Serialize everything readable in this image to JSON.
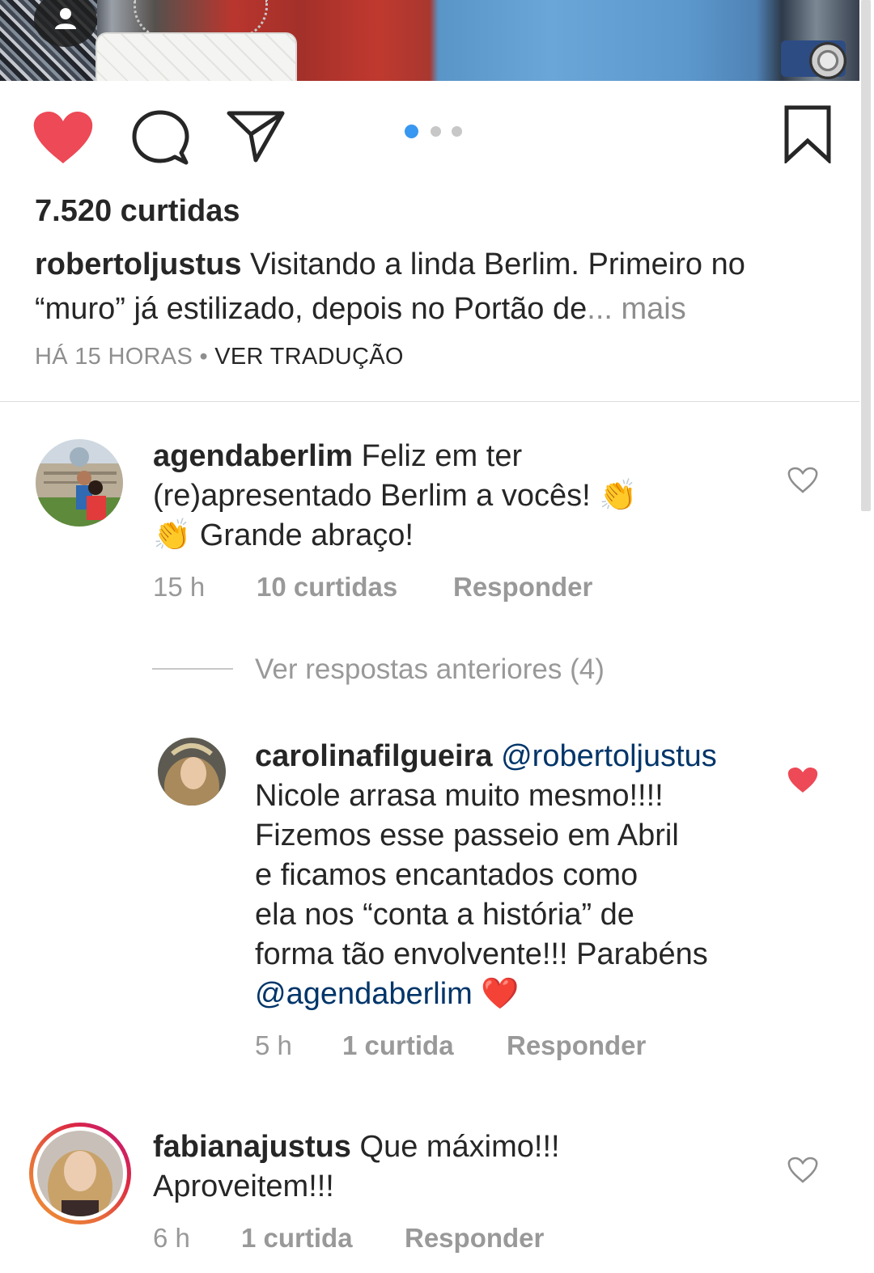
{
  "post": {
    "likes_text": "7.520 curtidas",
    "caption_user": "robertoljustus",
    "caption_text": " Visitando a linda Berlim. Primeiro no “muro” já estilizado, depois no Portão de",
    "caption_ellipsis": "...",
    "caption_more": " mais",
    "time_text": "HÁ 15 HORAS",
    "separator": " • ",
    "translate_text": "VER TRADUÇÃO",
    "carousel": {
      "total": 3,
      "active": 1
    },
    "liked": true,
    "accent_color": "#3897f0",
    "heart_color": "#ed4956"
  },
  "comments": [
    {
      "user": "agendaberlim",
      "text_line1": " Feliz em ter",
      "text_line2": "(re)apresentado Berlim a vocês! 👏",
      "text_line3": "👏 Grande abraço!",
      "time": "15 h",
      "likes": "10 curtidas",
      "reply": "Responder",
      "liked": false
    },
    {
      "user": "carolinafilgueira",
      "mention": " @robertoljustus",
      "line1": "Nicole arrasa muito mesmo!!!!",
      "line2": "Fizemos esse passeio em Abril",
      "line3": "e ficamos encantados como",
      "line4": "ela nos “conta a história” de",
      "line5": "forma tão envolvente!!! Parabéns",
      "mention2": "@agendaberlim",
      "emoji": " ❤️",
      "time": "5 h",
      "likes": "1 curtida",
      "reply": "Responder",
      "liked": true
    },
    {
      "user": "fabianajustus",
      "text_line1": " Que máximo!!!",
      "text_line2": "Aproveitem!!!",
      "time": "6 h",
      "likes": "1 curtida",
      "reply": "Responder",
      "liked": false
    }
  ],
  "view_replies": "Ver respostas anteriores (4)"
}
